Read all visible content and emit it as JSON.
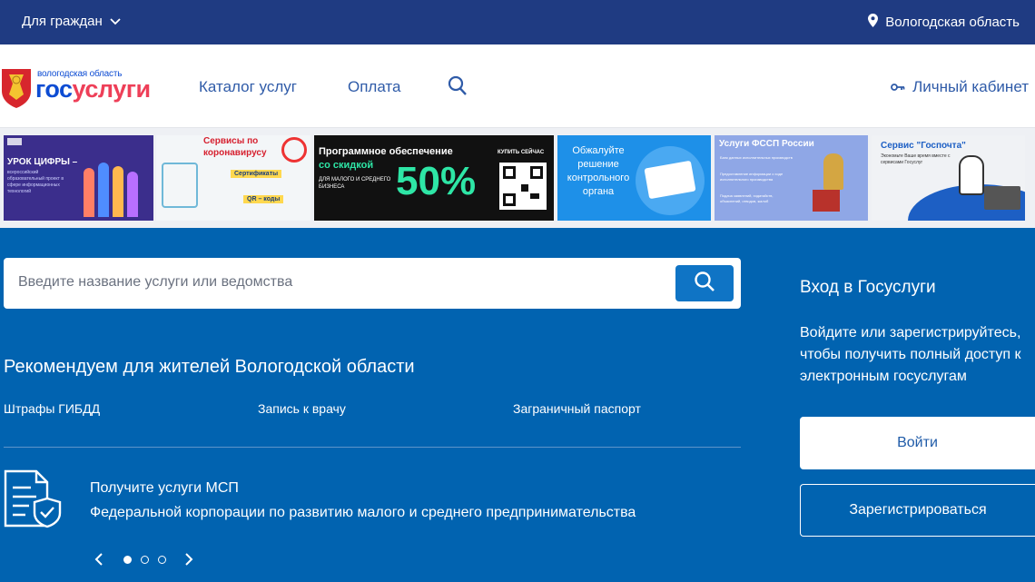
{
  "topbar": {
    "citizen_label": "Для граждан",
    "region_label": "Вологодская область"
  },
  "header": {
    "logo_region": "вологодская область",
    "logo_part1": "гос",
    "logo_part2": "услуги",
    "nav": [
      "Каталог услуг",
      "Оплата"
    ],
    "account_label": "Личный кабинет"
  },
  "banners": {
    "b1_title": "УРОК ЦИФРЫ –",
    "b1_sub": "всероссийский образовательный проект в сфере информационных технологий",
    "b2_title": "Сервисы по коронавирусу",
    "b2_tag1": "Сертификаты",
    "b2_tag2": "QR – коды",
    "b3_line1": "Программное обеспечение",
    "b3_line2": "со скидкой",
    "b3_line3": "ДЛЯ МАЛОГО И СРЕДНЕГО БИЗНЕСА",
    "b3_percent": "50%",
    "b3_buy": "КУПИТЬ СЕЙЧАС",
    "b4_text": "Обжалуйте решение контрольного органа",
    "b5_title": "Услуги ФССП России",
    "b5_lines": [
      "Банк данных исполнительных производств",
      "Предоставление информации о ходе исполнительного производства",
      "Подача заявлений, ходатайств, объяснений, отводов, жалоб"
    ],
    "b6_title": "Сервис \"Госпочта\"",
    "b6_sub": "Экономьте Ваше время вместе с сервисами Госуслуг"
  },
  "search": {
    "placeholder": "Введите название услуги или ведомства"
  },
  "recommend": {
    "title": "Рекомендуем для жителей Вологодской области",
    "links": [
      "Штрафы ГИБДД",
      "Запись к врачу",
      "Заграничный паспорт"
    ]
  },
  "msp": {
    "title": "Получите услуги МСП",
    "subtitle": "Федеральной корпорации по развитию малого и среднего предпринимательства"
  },
  "login": {
    "title": "Вход в Госуслуги",
    "text": "Войдите или зарегистрируйтесь, чтобы получить полный доступ к электронным госуслугам",
    "login_button": "Войти",
    "register_button": "Зарегистрироваться"
  },
  "colors": {
    "topbar": "#1f3b82",
    "main": "#0163b0",
    "brand_blue": "#0d4cd3",
    "brand_red": "#ee3f58"
  },
  "icons": [
    "chevron-down-icon",
    "location-pin-icon",
    "search-icon",
    "key-icon",
    "document-shield-icon",
    "chevron-left-icon",
    "chevron-right-icon"
  ]
}
